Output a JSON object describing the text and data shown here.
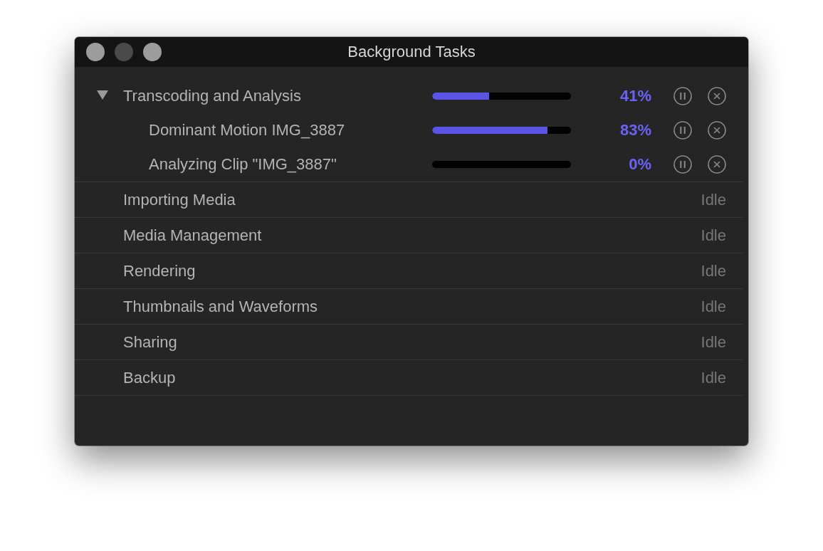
{
  "window": {
    "title": "Background Tasks"
  },
  "tasks": [
    {
      "name": "Transcoding and Analysis",
      "kind": "progress",
      "expanded": true,
      "level": 0.41,
      "percent": "41%",
      "children": [
        {
          "name": "Dominant Motion IMG_3887",
          "kind": "progress",
          "level": 0.83,
          "percent": "83%"
        },
        {
          "name": "Analyzing Clip \"IMG_3887\"",
          "kind": "progress",
          "level": 0,
          "percent": "0%"
        }
      ]
    },
    {
      "name": "Importing Media",
      "kind": "idle",
      "status": "Idle"
    },
    {
      "name": "Media Management",
      "kind": "idle",
      "status": "Idle"
    },
    {
      "name": "Rendering",
      "kind": "idle",
      "status": "Idle"
    },
    {
      "name": "Thumbnails and Waveforms",
      "kind": "idle",
      "status": "Idle"
    },
    {
      "name": "Sharing",
      "kind": "idle",
      "status": "Idle"
    },
    {
      "name": "Backup",
      "kind": "idle",
      "status": "Idle"
    }
  ]
}
